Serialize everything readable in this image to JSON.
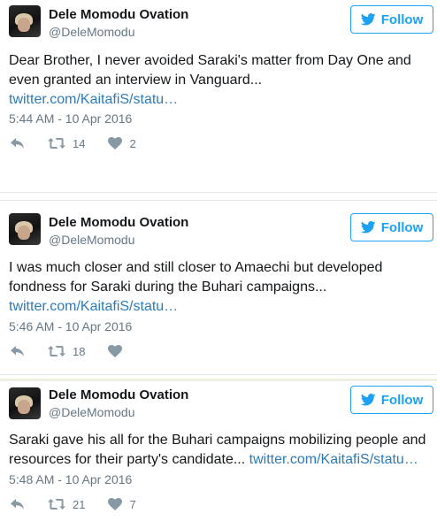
{
  "colors": {
    "accent": "#1da1f2",
    "link": "#2b7bb9",
    "muted": "#657786"
  },
  "icons": {
    "follow": "twitter-bird-icon",
    "reply": "reply-icon",
    "retweet": "retweet-icon",
    "like": "heart-icon"
  },
  "tweets": [
    {
      "author": "Dele Momodu Ovation",
      "handle": "@DeleMomodu",
      "follow_label": "Follow",
      "text_line1": "Dear Brother, I never avoided Saraki's matter from Day One and",
      "text_line2": "even granted an interview in Vanguard...",
      "link": "twitter.com/KaitafiS/statu…",
      "timestamp": "5:44 AM - 10 Apr 2016",
      "retweets": "14",
      "likes": "2"
    },
    {
      "author": "Dele Momodu Ovation",
      "handle": "@DeleMomodu",
      "follow_label": "Follow",
      "text_line1": "I was much closer and still closer to Amaechi but developed",
      "text_line2": "fondness for Saraki during the Buhari campaigns...",
      "link": "twitter.com/KaitafiS/statu…",
      "timestamp": "5:46 AM - 10 Apr 2016",
      "retweets": "18",
      "likes": ""
    },
    {
      "author": "Dele Momodu Ovation",
      "handle": "@DeleMomodu",
      "follow_label": "Follow",
      "text_line1": "Saraki gave his all for the Buhari campaigns mobilizing people and",
      "text_line2": "resources for their party's candidate...",
      "link": "twitter.com/KaitafiS/statu…",
      "timestamp": "5:48 AM - 10 Apr 2016",
      "retweets": "21",
      "likes": "7"
    }
  ]
}
